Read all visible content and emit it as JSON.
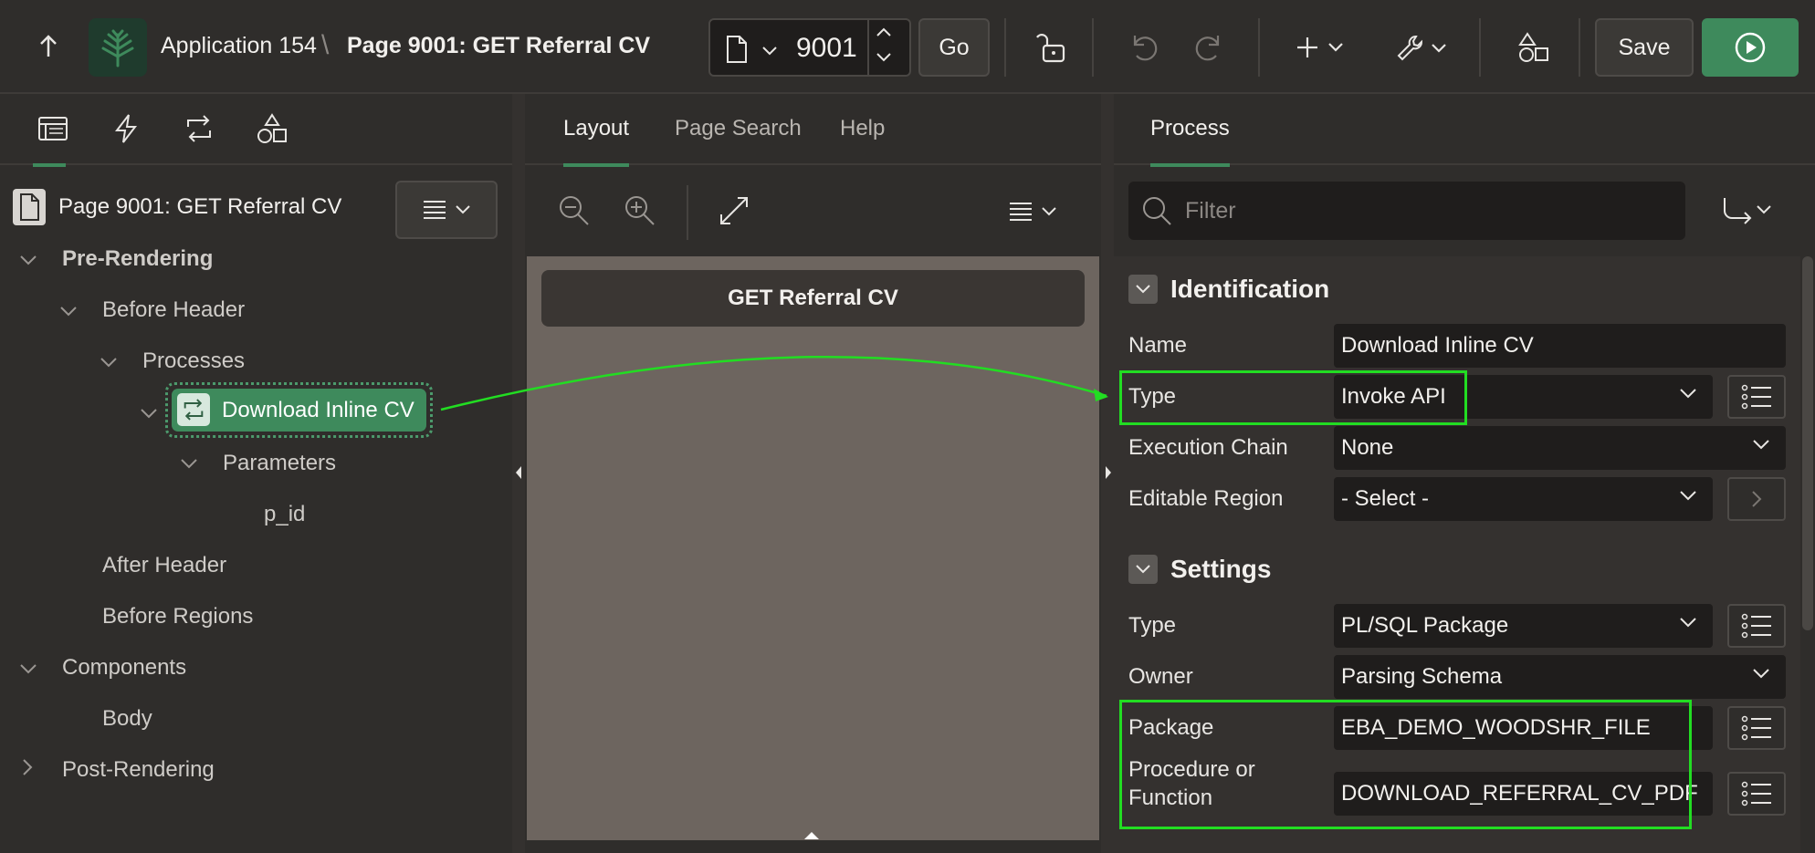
{
  "header": {
    "app_name": "Application 154",
    "separator": "\\",
    "page_name": "Page 9001: GET Referral CV",
    "page_number": "9001",
    "go_label": "Go",
    "save_label": "Save"
  },
  "left_pane": {
    "tabs": [
      "rendering-tab",
      "dynamic-actions-tab",
      "processing-tab",
      "shared-components-tab"
    ],
    "page_title": "Page 9001: GET Referral CV",
    "tree": {
      "pre_rendering": "Pre-Rendering",
      "before_header": "Before Header",
      "processes": "Processes",
      "download_inline_cv": "Download Inline CV",
      "parameters": "Parameters",
      "p_id": "p_id",
      "after_header": "After Header",
      "before_regions": "Before Regions",
      "components": "Components",
      "body": "Body",
      "post_rendering": "Post-Rendering"
    }
  },
  "middle_pane": {
    "tabs": {
      "layout": "Layout",
      "page_search": "Page Search",
      "help": "Help"
    },
    "region_title": "GET Referral CV"
  },
  "right_pane": {
    "tab": "Process",
    "filter_placeholder": "Filter",
    "identification": {
      "title": "Identification",
      "name_label": "Name",
      "name_value": "Download Inline CV",
      "type_label": "Type",
      "type_value": "Invoke API",
      "exec_label": "Execution Chain",
      "exec_value": "None",
      "region_label": "Editable Region",
      "region_value": "- Select -"
    },
    "settings": {
      "title": "Settings",
      "type_label": "Type",
      "type_value": "PL/SQL Package",
      "owner_label": "Owner",
      "owner_value": "Parsing Schema",
      "package_label": "Package",
      "package_value": "EBA_DEMO_WOODSHR_FILE",
      "proc_label_1": "Procedure or",
      "proc_label_2": "Function",
      "proc_value": "DOWNLOAD_REFERRAL_CV_PDF"
    }
  },
  "colors": {
    "accent": "#3e8a5c",
    "highlight": "#22dd22",
    "background": "#2f2d2b"
  }
}
